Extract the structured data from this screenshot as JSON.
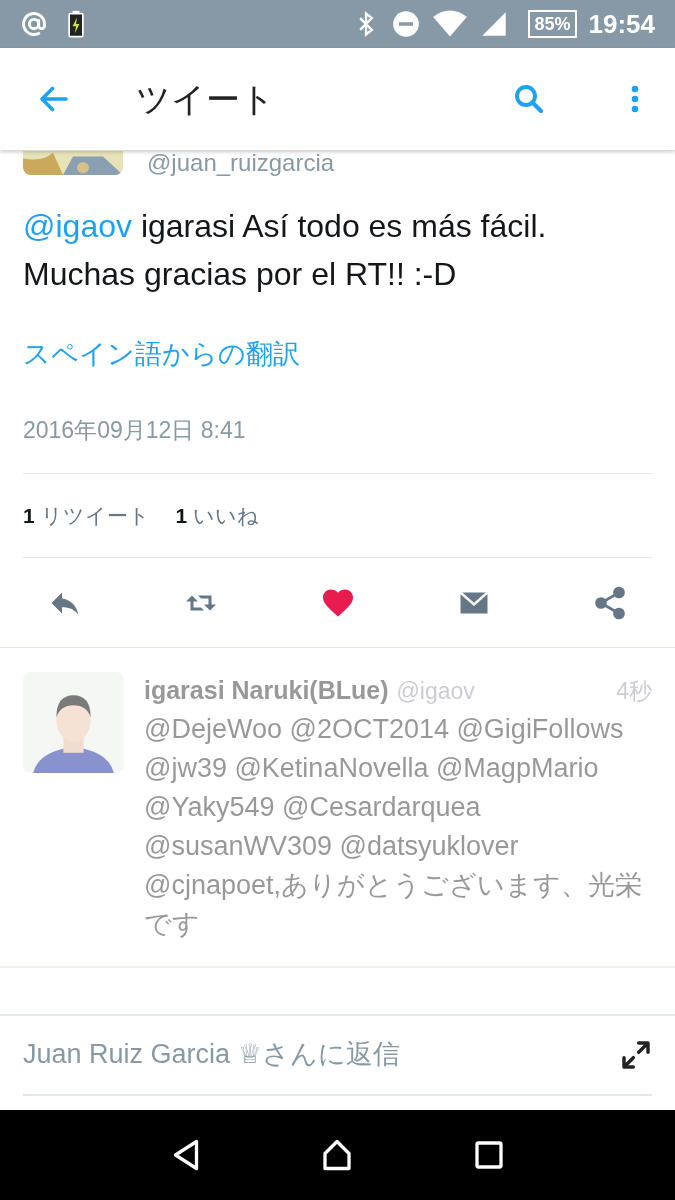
{
  "status_bar": {
    "battery": "85%",
    "time": "19:54"
  },
  "header": {
    "title": "ツイート"
  },
  "tweet": {
    "handle": "@juan_ruizgarcia",
    "mention": "@igaov",
    "text": "igarasi Así todo es más fácil. Muchas gracias por el RT!! :-D",
    "translate_link": "スペイン語からの翻訳",
    "date": "2016年09月12日 8:41",
    "stats": [
      {
        "count": "1",
        "label": "リツイート"
      },
      {
        "count": "1",
        "label": "いいね"
      }
    ],
    "actions": [
      {
        "kind": "reply",
        "selected": false
      },
      {
        "kind": "retweet",
        "selected": false
      },
      {
        "kind": "like",
        "selected": true
      },
      {
        "kind": "message",
        "selected": false
      },
      {
        "kind": "share",
        "selected": false
      }
    ]
  },
  "replies": [
    {
      "name": "igarasi Naruki(BLue)",
      "handle": "@igaov",
      "time": "4秒",
      "text": "@DejeWoo @2OCT2014 @GigiFollows @jw39 @KetinaNovella @MagpMario @Yaky549 @Cesardarquea @susanWV309 @datsyuklover @cjnapoet,ありがとうございます、光栄です"
    }
  ],
  "reply_box": {
    "placeholder": "Juan Ruiz Garcia ♕さんに返信"
  }
}
